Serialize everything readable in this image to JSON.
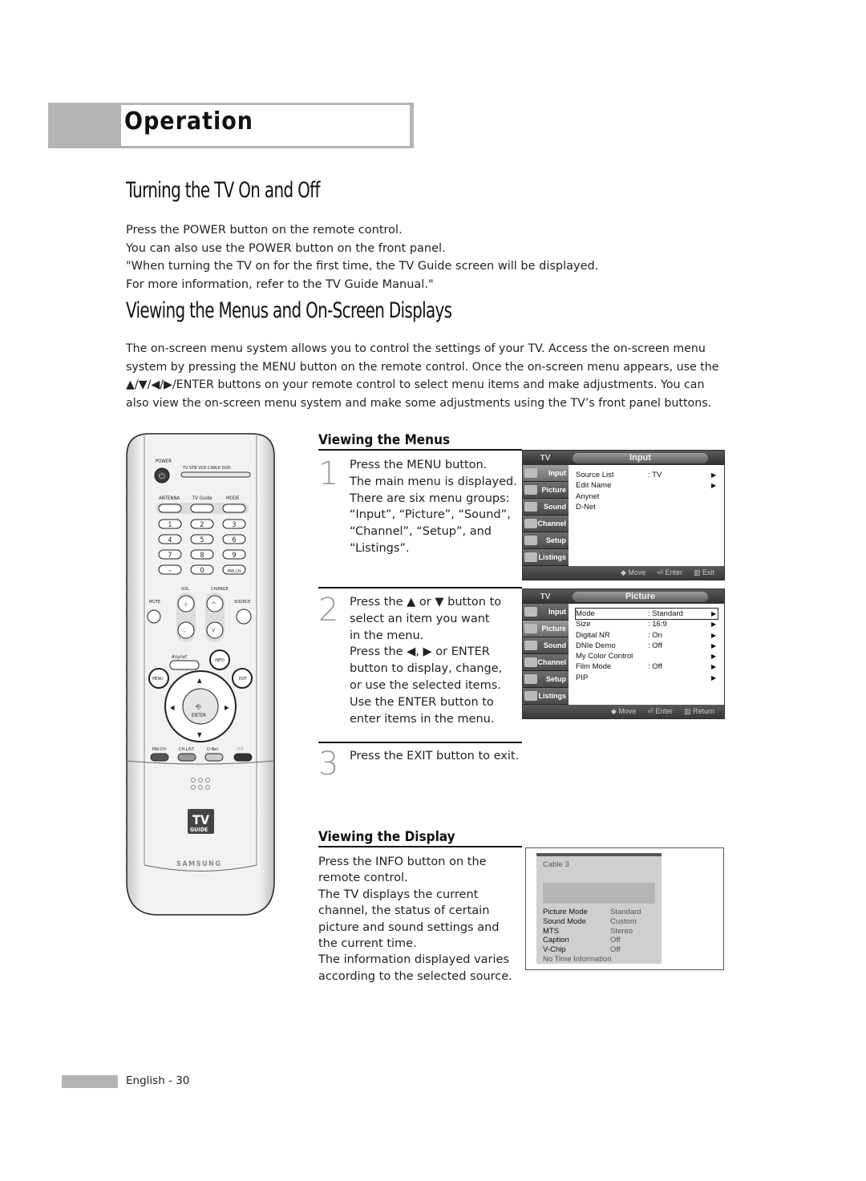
{
  "header": {
    "section": "Operation"
  },
  "turning_on_off": {
    "title": "Turning the TV On and Off",
    "lines": [
      "Press the POWER button on the remote control.",
      "You can also use the POWER button on the front panel.",
      "\"When turning the TV on for the first time, the TV Guide screen will be displayed.",
      "For more information, refer to the TV Guide Manual.\""
    ]
  },
  "menus_osd": {
    "title": "Viewing the Menus and On-Screen Displays",
    "lines": [
      "The on-screen menu system allows you to control the settings of your TV. Access the on-screen menu",
      "system by pressing the MENU button on the remote control. Once the on-screen menu appears, use the",
      "▲/▼/◀/▶/ENTER buttons on your remote control to select menu items and make adjustments. You can",
      "also view the on-screen menu system and make some adjustments using the TV’s front panel buttons."
    ]
  },
  "viewing_menus": {
    "title": "Viewing the Menus",
    "steps": [
      {
        "num": "1",
        "lines": [
          "Press the MENU button.",
          "The main menu is displayed.",
          "There are six menu groups:",
          "“Input”, “Picture”, “Sound”,",
          "“Channel”, “Setup”, and",
          "“Listings”."
        ]
      },
      {
        "num": "2",
        "lines": [
          "Press the ▲ or ▼ button to",
          "select an item you want",
          "in the menu.",
          "Press the ◀, ▶ or ENTER",
          "button to display, change,",
          "or use the selected items.",
          "Use the ENTER button to",
          "enter items in the menu."
        ]
      },
      {
        "num": "3",
        "lines": [
          "Press the EXIT button to exit."
        ]
      }
    ]
  },
  "osd_menus": [
    {
      "tv_label": "TV",
      "title": "Input",
      "sidebar": [
        "Input",
        "Picture",
        "Sound",
        "Channel",
        "Setup",
        "Listings"
      ],
      "active": "Input",
      "rows": [
        {
          "key": "Source List",
          "value": ": TV",
          "arrow": "▶"
        },
        {
          "key": "Edit Name",
          "value": "",
          "arrow": "▶"
        },
        {
          "key": "Anynet",
          "value": "",
          "arrow": ""
        },
        {
          "key": "D-Net",
          "value": "",
          "arrow": ""
        }
      ],
      "footer": [
        "◆ Move",
        "⏎ Enter",
        "▥ Exit"
      ]
    },
    {
      "tv_label": "TV",
      "title": "Picture",
      "sidebar": [
        "Input",
        "Picture",
        "Sound",
        "Channel",
        "Setup",
        "Listings"
      ],
      "active": "Picture",
      "rows": [
        {
          "key": "Mode",
          "value": ": Standard",
          "arrow": "▶"
        },
        {
          "key": "Size",
          "value": ": 16:9",
          "arrow": "▶"
        },
        {
          "key": "Digital NR",
          "value": ": On",
          "arrow": "▶"
        },
        {
          "key": "DNIe Demo",
          "value": ": Off",
          "arrow": "▶"
        },
        {
          "key": "My Color Control",
          "value": "",
          "arrow": "▶"
        },
        {
          "key": "Film Mode",
          "value": ": Off",
          "arrow": "▶"
        },
        {
          "key": "PIP",
          "value": "",
          "arrow": "▶"
        }
      ],
      "footer": [
        "◆ Move",
        "⏎ Enter",
        "▥ Return"
      ]
    }
  ],
  "viewing_display": {
    "title": "Viewing the Display",
    "lines": [
      "Press the INFO button on the",
      "remote control.",
      "The TV displays the current",
      "channel, the status of certain",
      "picture and sound settings and",
      "the current time.",
      "The information displayed varies",
      "according to the selected source."
    ]
  },
  "info_display": {
    "channel": "Cable 3",
    "rows": [
      {
        "key": "Picture Mode",
        "value": "Standard"
      },
      {
        "key": "Sound Mode",
        "value": "Custom"
      },
      {
        "key": "MTS",
        "value": "Stereo"
      },
      {
        "key": "Caption",
        "value": "Off"
      },
      {
        "key": "V-Chip",
        "value": "Off"
      }
    ],
    "footer": "No Time Information"
  },
  "remote": {
    "power": "POWER",
    "modes": "TV  STB  VCR  CABLE  DVD",
    "antenna": "ANTENNA",
    "tvguide": "TV Guide",
    "mode": "MODE",
    "digits": [
      "1",
      "2",
      "3",
      "4",
      "5",
      "6",
      "7",
      "8",
      "9",
      "–",
      "0",
      "PRE-CH"
    ],
    "vol": "VOL",
    "chpage": "CH/PAGE",
    "mute": "MUTE",
    "source": "SOURCE",
    "anynet": "Anynet",
    "info": "INFO",
    "menu": "MENU",
    "exit": "EXIT",
    "enter": "ENTER",
    "bottom": [
      "FAV.CH",
      "CH.LIST",
      "D-Net",
      "PIP"
    ],
    "logo_tv": "TV",
    "logo_guide": "GUIDE",
    "brand": "SAMSUNG"
  },
  "footer": {
    "page": "English - 30"
  }
}
